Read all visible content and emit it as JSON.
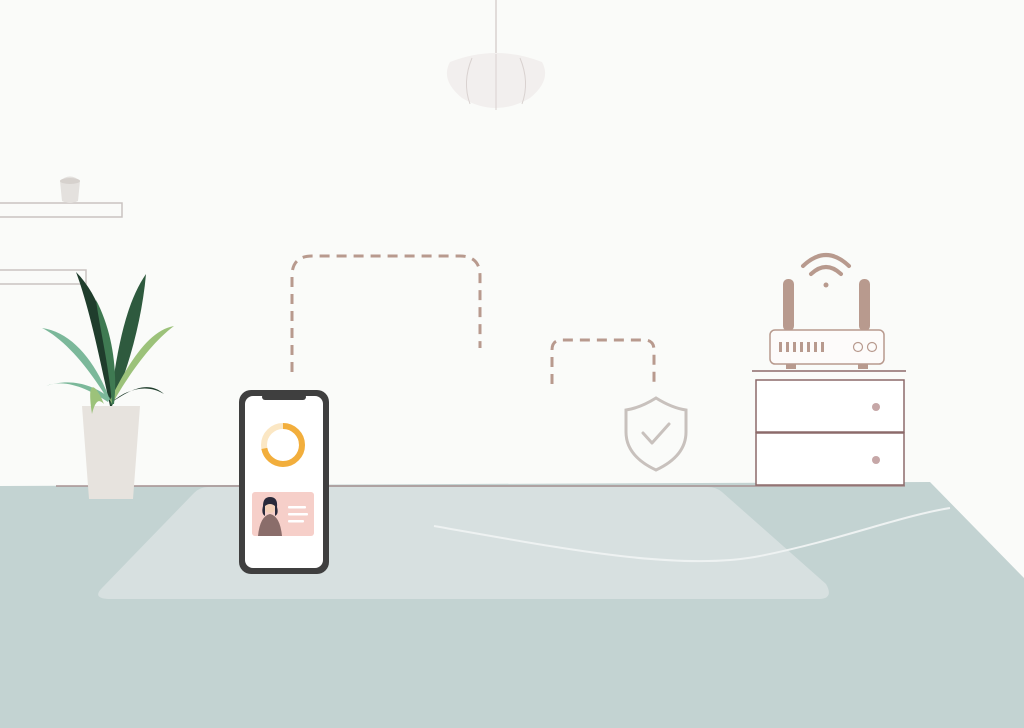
{
  "scene": {
    "type": "illustration",
    "subject": "smart-home-network-security",
    "text_elements": []
  },
  "colors": {
    "wall": "#fafbf9",
    "floor": "#c3d3d2",
    "rug": "#d7e0e0",
    "rug_line": "#eef2f2",
    "lamp_shade": "#f2efee",
    "lamp_line": "#d9d2d0",
    "shelf_stroke": "#c9c3c1",
    "pot": "#e7e3de",
    "leaf_dark": "#1f3d2c",
    "leaf_mid": "#7bb89a",
    "leaf_light": "#9cc27a",
    "phone_frame": "#3f3f3f",
    "phone_screen": "#ffffff",
    "donut_fill": "#f2ae3c",
    "donut_track": "#fbe7c4",
    "card_bg": "#f6cfc9",
    "dash_line": "#b89a8e",
    "shield": "#c8c1bd",
    "router": "#b89a8e",
    "router_body": "#fdfbfa",
    "cabinet_stroke": "#8c6a6a",
    "cabinet_knob": "#c6a7a7"
  },
  "icons": {
    "phone_progress_fraction": 0.72
  }
}
